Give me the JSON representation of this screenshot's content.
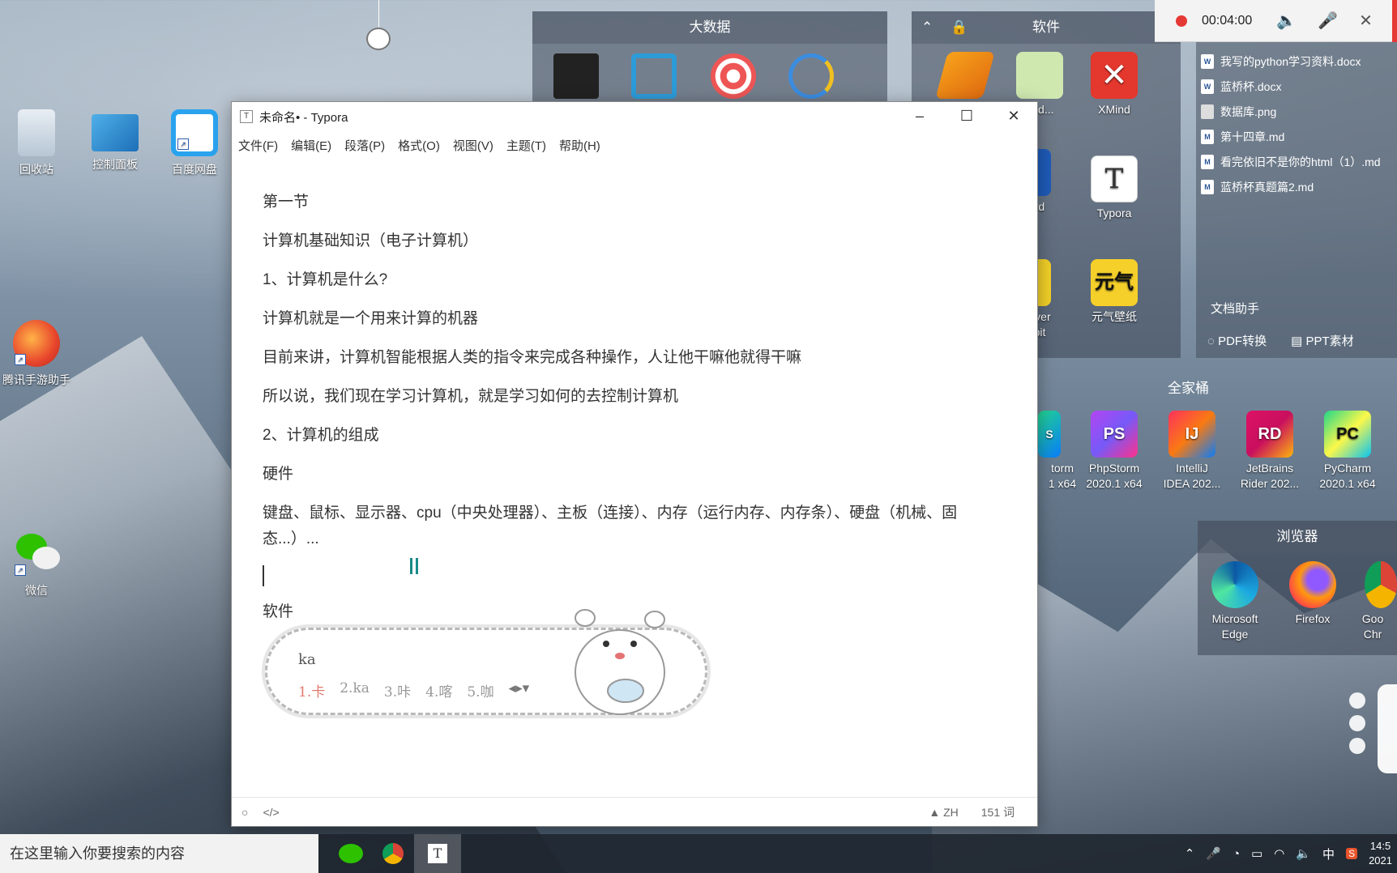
{
  "desktop_icons": [
    {
      "label": "回收站"
    },
    {
      "label": "控制面板"
    },
    {
      "label": "百度网盘"
    },
    {
      "label": "腾讯手游助手"
    },
    {
      "label": "微信"
    }
  ],
  "fence_bigdata": {
    "title": "大数据"
  },
  "fence_software": {
    "title": "软件",
    "items": [
      {
        "label": "XMind"
      },
      {
        "label": "Typora"
      },
      {
        "label": "元气壁纸"
      },
      {
        "label": "pad..."
      },
      {
        "label": "rd"
      },
      {
        "label": "ayer"
      },
      {
        "label": "bit"
      }
    ]
  },
  "fence_jetbrains": {
    "title": "全家桶",
    "items": [
      {
        "label": "torm"
      },
      {
        "label": "1 x64"
      },
      {
        "label": "PhpStorm"
      },
      {
        "label": "2020.1 x64"
      },
      {
        "label": "IntelliJ"
      },
      {
        "label": "IDEA 202..."
      },
      {
        "label": "JetBrains"
      },
      {
        "label": "Rider 202..."
      },
      {
        "label": "PyCharm"
      },
      {
        "label": "2020.1 x64"
      }
    ],
    "badges": [
      "S",
      "PS",
      "IJ",
      "RD",
      "PC"
    ]
  },
  "fence_browser": {
    "title": "浏览器",
    "items": [
      {
        "label": "Microsoft"
      },
      {
        "label": "Edge"
      },
      {
        "label": "Firefox"
      },
      {
        "label": "Goo"
      },
      {
        "label": "Chr"
      }
    ]
  },
  "recorder": {
    "time": "00:04:00"
  },
  "recent_files": [
    "我写的python学习资料.docx",
    "蓝桥杯.docx",
    "数据库.png",
    "第十四章.md",
    "看完依旧不是你的html（1）.md",
    "蓝桥杯真题篇2.md"
  ],
  "doc_helper": {
    "title": "文档助手",
    "pdf": "PDF转换",
    "ppt": "PPT素材"
  },
  "typora": {
    "title": "未命名• - Typora",
    "logo": "T",
    "menu": [
      "文件(F)",
      "编辑(E)",
      "段落(P)",
      "格式(O)",
      "视图(V)",
      "主题(T)",
      "帮助(H)"
    ],
    "paragraphs": [
      "第一节",
      "计算机基础知识（电子计算机）",
      "1、计算机是什么?",
      "计算机就是一个用来计算的机器",
      "目前来讲，计算机智能根据人类的指令来完成各种操作，人让他干嘛他就得干嘛",
      "所以说，我们现在学习计算机，就是学习如何的去控制计算机",
      "2、计算机的组成",
      "硬件",
      "键盘、鼠标、显示器、cpu（中央处理器）、主板（连接）、内存（运行内存、内存条）、硬盘（机械、固态...）..."
    ],
    "after_caret": "软件",
    "status": {
      "lang": "ZH",
      "words": "151 词"
    }
  },
  "ime": {
    "input": "ka",
    "candidates": [
      "1.卡",
      "2.ka",
      "3.咔",
      "4.喀",
      "5.咖"
    ]
  },
  "taskbar": {
    "search_placeholder": "在这里输入你要搜索的内容",
    "ime_lang": "中",
    "time": "14:5",
    "date": "2021"
  }
}
